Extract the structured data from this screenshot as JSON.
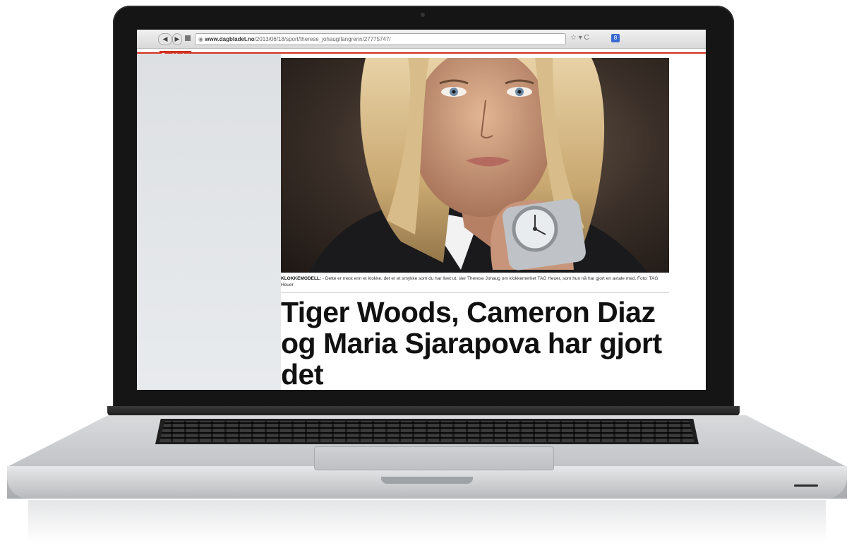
{
  "browser": {
    "back_label": "◀",
    "forward_label": "▶",
    "reader_icon": "grid-icon",
    "site_icon": "globe-icon",
    "url_domain": "www.dagbladet.no",
    "url_path": "/2013/06/18/sport/therese_johaug/langrenn/27775747/",
    "actions": "☆ ▾ C",
    "addon": "8"
  },
  "site": {
    "logo": "Dagbladet"
  },
  "article": {
    "caption_lead": "KLOKKEMODELL:",
    "caption_text": " - Dette er mest enn et klokke, det er et smykke som du har livet ut, sier Therese Johaug om klokkemerket TAG Heuer, som hun nå har gjort en avtale med. Foto: TAG Heuer",
    "headline": "Tiger Woods, Cameron Diaz og Maria Sjarapova har gjort det"
  },
  "colors": {
    "brand_red": "#d0321f",
    "sidebar": "#dde0e3"
  }
}
